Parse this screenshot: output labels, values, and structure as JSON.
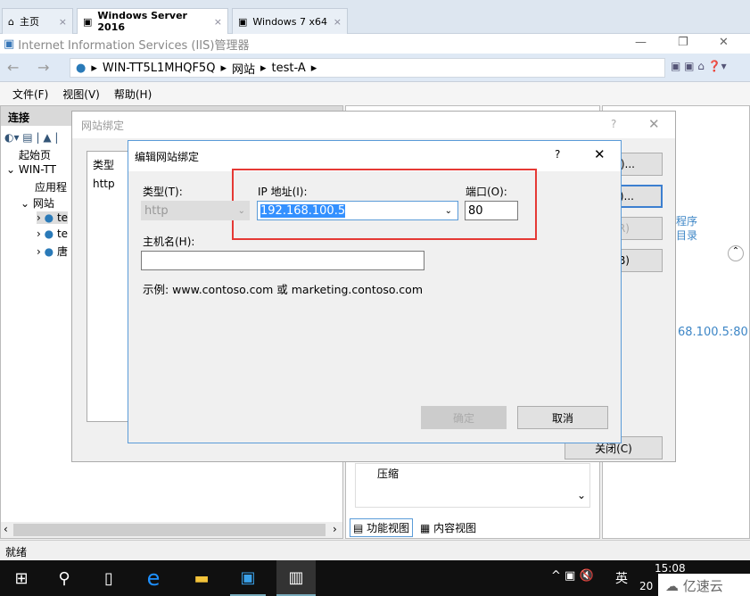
{
  "browser_tabs": [
    {
      "label": "主页",
      "icon": "home-icon"
    },
    {
      "label": "Windows Server 2016",
      "icon": "vm-icon",
      "active": true
    },
    {
      "label": "Windows 7 x64",
      "icon": "vm-icon"
    }
  ],
  "window": {
    "title": "Internet Information Services (IIS)管理器"
  },
  "address": {
    "segments": [
      "WIN-TT5L1MHQF5Q",
      "网站",
      "test-A"
    ]
  },
  "menu": [
    "文件(F)",
    "视图(V)",
    "帮助(H)"
  ],
  "connections": {
    "title": "连接",
    "tree": [
      "起始页",
      "WIN-TT",
      "应用程",
      "网站",
      "te",
      "te",
      "唐"
    ]
  },
  "center": {
    "item": "压缩",
    "bottom_tabs": [
      "功能视图",
      "内容视图"
    ]
  },
  "right": {
    "links": [
      "程序",
      "目录"
    ],
    "binding": "68.100.5:80"
  },
  "status": "就绪",
  "bindings_dialog": {
    "title": "网站绑定",
    "help": "?",
    "columns": [
      "类型"
    ],
    "rows": [
      "http"
    ],
    "buttons": [
      ")...",
      ")...",
      "R)",
      "B)",
      "关闭(C)"
    ]
  },
  "edit_dialog": {
    "title": "编辑网站绑定",
    "help": "?",
    "type_label": "类型(T):",
    "type_value": "http",
    "ip_label": "IP 地址(I):",
    "ip_value": "192.168.100.5",
    "port_label": "端口(O):",
    "port_value": "80",
    "host_label": "主机名(H):",
    "host_value": "",
    "example": "示例: www.contoso.com 或 marketing.contoso.com",
    "ok": "确定",
    "cancel": "取消",
    "highlight_color": "#e53935"
  },
  "tray": {
    "ime": "英",
    "time": "15:08",
    "date_partial": "20",
    "watermark": "亿速云"
  }
}
